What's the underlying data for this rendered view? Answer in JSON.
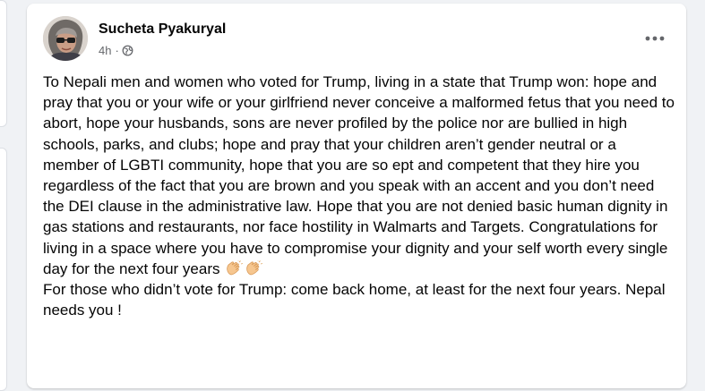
{
  "post": {
    "author_name": "Sucheta Pyakuryal",
    "timestamp": "4h",
    "separator": "·",
    "audience_icon": "globe-icon",
    "more_icon": "more-options-icon",
    "paragraph_1": "To Nepali men and women who voted for Trump, living in a state that Trump won: hope and pray that you or your wife or your girlfriend never conceive a malformed fetus that you need to abort, hope your husbands, sons are never profiled by the police nor are bullied in high schools, parks, and clubs; hope and pray that your children aren’t gender neutral or a member of LGBTI community, hope that you are so ept and competent that they hire you regardless of the fact that you are brown and you speak with an accent and you don’t need the DEI clause in the administrative law. Hope that you are not denied basic human dignity in gas stations and restaurants, nor face hostility in Walmarts and Targets. Congratulations for living in a space where you have to compromise your dignity and your self worth every single day for the next four years",
    "paragraph_1_emoji": [
      "clapping-hands-icon",
      "clapping-hands-icon"
    ],
    "paragraph_2": "For those who didn’t vote for Trump: come back home, at least for the next four years. Nepal needs you !"
  },
  "colors": {
    "page_background": "#f0f2f5",
    "card_background": "#ffffff",
    "primary_text": "#050505",
    "secondary_text": "#65676b"
  }
}
